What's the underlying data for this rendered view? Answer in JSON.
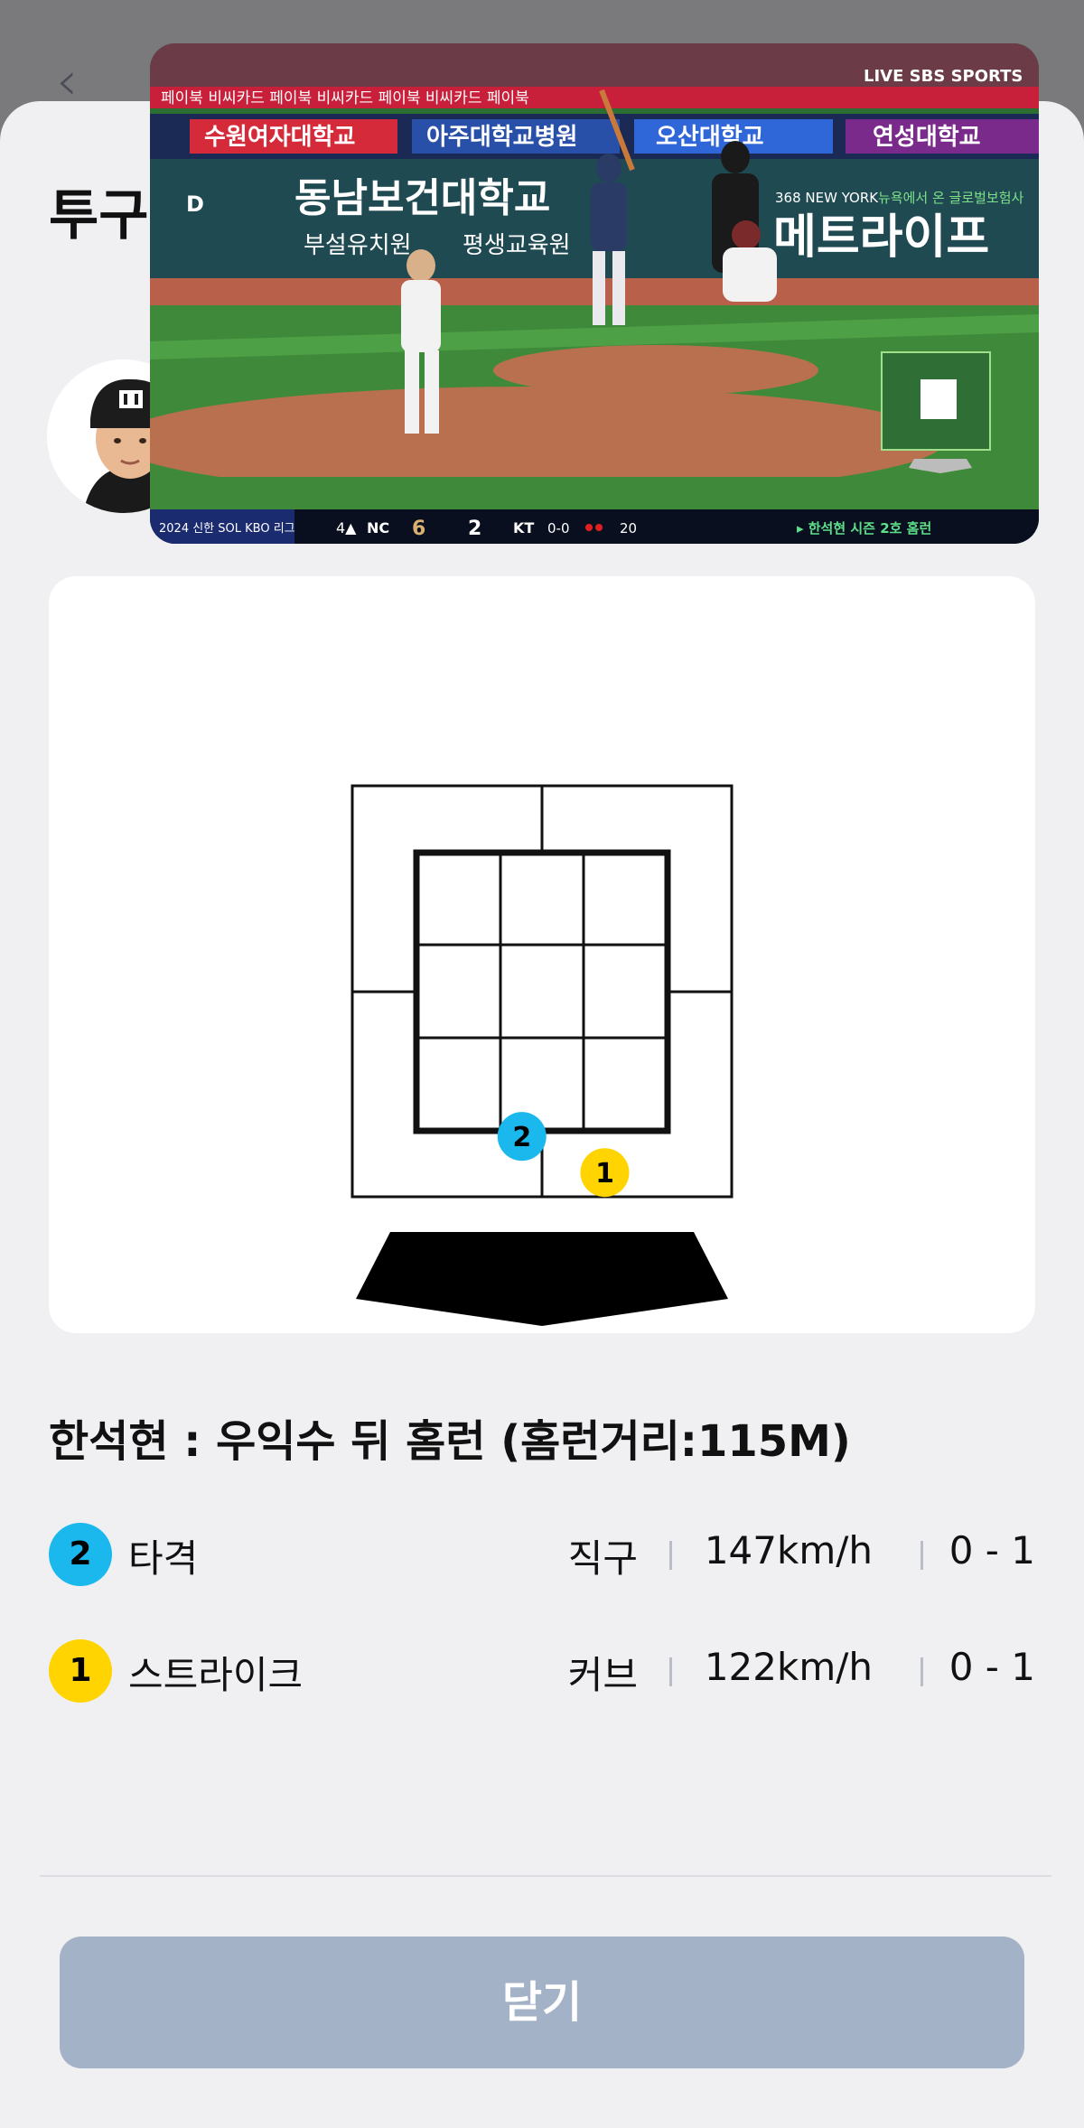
{
  "header": {
    "title": "투구"
  },
  "video_overlay": {
    "stands_banner": "페이북  비씨카드  페이북  비씨카드  페이북  비씨카드  페이북",
    "broadcaster_logo": "LIVE SBS SPORTS",
    "ad_board_1": "수원여자대학교",
    "ad_board_2": "아주대학교병원",
    "ad_board_3": "오산대학교",
    "ad_board_4": "연성대학교",
    "ad_wall_main": "동남보건대학교",
    "ad_wall_sub_1": "부설유치원",
    "ad_wall_sub_2": "평생교육원",
    "ad_wall_right": "메트라이프",
    "ad_wall_small_1": "368 NEW YORK",
    "ad_wall_small_2": "뉴욕에서 온 글로벌보험사",
    "scorebar": {
      "league": "2024 신한 SOL KBO 리그",
      "inning": "4▲",
      "away_team": "NC",
      "away_score": "6",
      "home_score": "2",
      "home_team": "KT",
      "count": "0-0",
      "pitch_count": "20",
      "caption": "▸ 한석현 시즌 2호 홈런"
    }
  },
  "pitches": {
    "result_title": "한석현 : 우익수 뒤 홈런 (홈런거리:115M)",
    "items": [
      {
        "number": "2",
        "result": "타격",
        "pitch_type": "직구",
        "speed": "147km/h",
        "count": "0 - 1",
        "color": "#1bb8ee",
        "zone_x": 0.42,
        "zone_y": -0.02
      },
      {
        "number": "1",
        "result": "스트라이크",
        "pitch_type": "커브",
        "speed": "122km/h",
        "count": "0 - 1",
        "color": "#ffd400",
        "zone_x": 0.75,
        "zone_y": -0.15
      }
    ]
  },
  "footer": {
    "close_label": "닫기"
  },
  "colors": {
    "close_button": "#a3b2c6",
    "pitch2": "#1bb8ee",
    "pitch1": "#ffd400"
  }
}
